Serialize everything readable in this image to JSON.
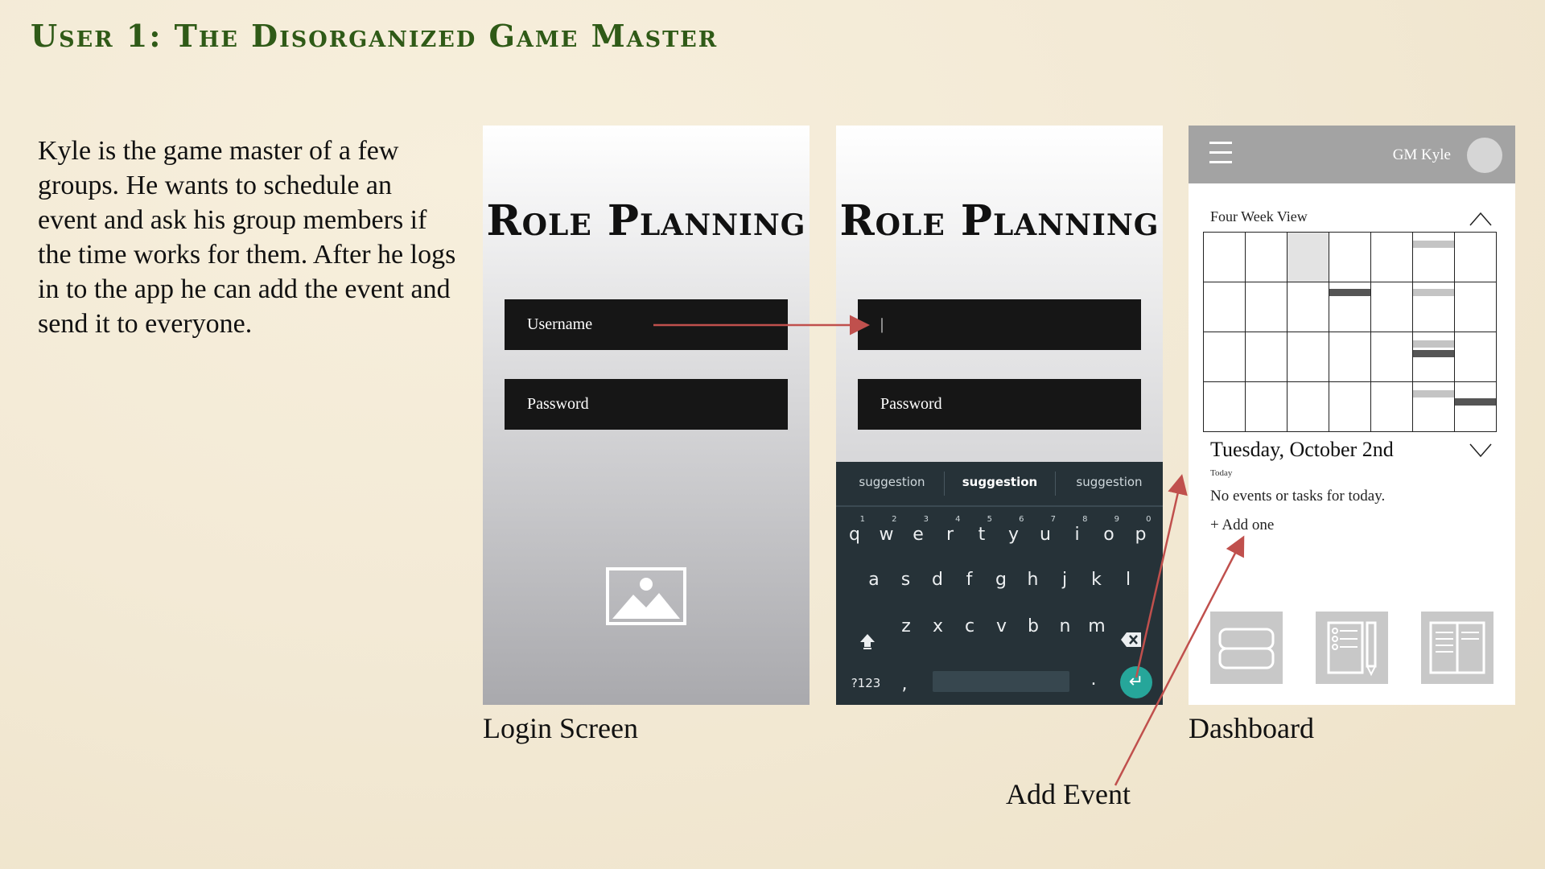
{
  "slide": {
    "title": "User 1: The Disorganized Game Master",
    "story": "Kyle is the game master of a few groups. He wants to schedule an event and ask his group members if the time works for them. After he logs in to the app he can add the event and send it to everyone.",
    "captions": {
      "login": "Login Screen",
      "dashboard": "Dashboard",
      "add_event": "Add Event"
    },
    "arrow_color": "#c0504d"
  },
  "login_screen": {
    "app_title": "Role Planning",
    "username_placeholder": "Username",
    "password_placeholder": "Password",
    "image_icon": "image-placeholder-icon"
  },
  "login_typing_screen": {
    "app_title": "Role Planning",
    "username_value": "|",
    "password_placeholder": "Password",
    "keyboard": {
      "suggestions": [
        "suggestion",
        "suggestion",
        "suggestion"
      ],
      "row1": [
        "q",
        "w",
        "e",
        "r",
        "t",
        "y",
        "u",
        "i",
        "o",
        "p"
      ],
      "row1_numbers": [
        "1",
        "2",
        "3",
        "4",
        "5",
        "6",
        "7",
        "8",
        "9",
        "0"
      ],
      "row2": [
        "a",
        "s",
        "d",
        "f",
        "g",
        "h",
        "j",
        "k",
        "l"
      ],
      "row3": [
        "z",
        "x",
        "c",
        "v",
        "b",
        "n",
        "m"
      ],
      "symbols_key": "?123",
      "comma_key": ",",
      "period_key": ".",
      "accent_color": "#26a69a"
    }
  },
  "dashboard": {
    "user_name": "GM Kyle",
    "calendar_title": "Four Week View",
    "date_heading": "Tuesday, October 2nd",
    "today_label": "Today",
    "empty_message": "No events or tasks for today.",
    "add_link": "+ Add one",
    "nav_tiles": [
      "chat-icon",
      "notes-icon",
      "book-icon"
    ]
  }
}
